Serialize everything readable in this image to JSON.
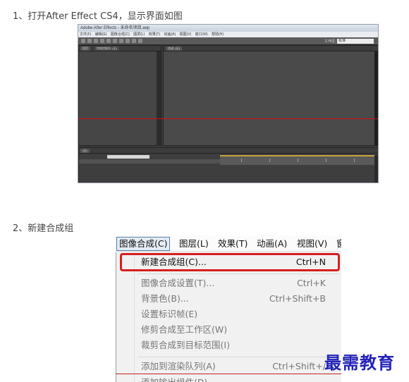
{
  "steps": {
    "step1": "1、打开After Effect CS4，显示界面如图",
    "step2": "2、新建合成组"
  },
  "ae_screenshot": {
    "title": "Adobe After Effects - 未命名项目.aep",
    "menu": [
      "文件(F)",
      "编辑(E)",
      "图像合成(C)",
      "图层(L)",
      "效果(T)",
      "动画(A)",
      "视图(V)",
      "窗口(W)",
      "帮助(H)"
    ],
    "workspace_label": "工作区:",
    "workspace_value": "标准",
    "project_tabs": [
      "项目",
      "特效控制台: (无)"
    ],
    "composition_tab": "合成: (无)",
    "timeline_tab": "(无)",
    "accent_red": "#d01010"
  },
  "menu_screenshot": {
    "menubar": [
      "图像合成(C)",
      "图层(L)",
      "效果(T)",
      "动画(A)",
      "视图(V)",
      "窗"
    ],
    "items": [
      {
        "label": "新建合成组(C)...",
        "shortcut": "Ctrl+N",
        "enabled": true,
        "highlighted": true
      },
      {
        "label": "图像合成设置(T)...",
        "shortcut": "Ctrl+K",
        "enabled": false
      },
      {
        "label": "背景色(B)...",
        "shortcut": "Ctrl+Shift+B",
        "enabled": false
      },
      {
        "label": "设置标识帧(E)",
        "shortcut": "",
        "enabled": false
      },
      {
        "label": "修剪合成至工作区(W)",
        "shortcut": "",
        "enabled": false
      },
      {
        "label": "裁剪合成到目标范围(I)",
        "shortcut": "",
        "enabled": false
      },
      {
        "label": "添加到渲染队列(A)",
        "shortcut": "Ctrl+Shift+/",
        "enabled": false
      },
      {
        "label": "添加输出组件(D)",
        "shortcut": "",
        "enabled": false
      }
    ],
    "highlight_color": "#d81e1e"
  },
  "watermark": "最需教育"
}
